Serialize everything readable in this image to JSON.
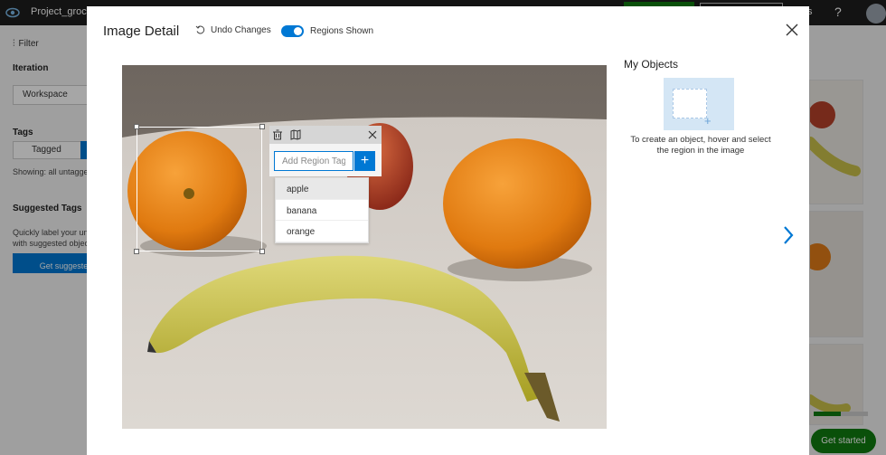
{
  "background": {
    "project_name": "Project_grocery",
    "topbar_letter": "s",
    "help_label": "?",
    "sidebar": {
      "filter_label": "Filter",
      "iteration_heading": "Iteration",
      "iteration_value": "Workspace",
      "tags_heading": "Tags",
      "tagged_label": "Tagged",
      "showing_text": "Showing: all untagged",
      "suggested_heading": "Suggested Tags",
      "suggested_desc_1": "Quickly label your untagged",
      "suggested_desc_2": "with suggested objects",
      "suggested_button": "Get suggested"
    },
    "get_started_label": "Get started",
    "progress_fraction": 0.5
  },
  "modal": {
    "title": "Image Detail",
    "undo_label": "Undo Changes",
    "regions_label": "Regions Shown",
    "regions_toggle_on": true,
    "tag_input_placeholder": "Add Region Tag",
    "tag_add_symbol": "+",
    "tag_suggestions": [
      "apple",
      "banana",
      "orange"
    ],
    "highlighted_suggestion": "apple",
    "objects_title": "My Objects",
    "objects_hint": "To create an object, hover and select the region in the image"
  },
  "colors": {
    "accent": "#0078d4",
    "success": "#107c10",
    "card_bg": "#d4e6f5"
  }
}
